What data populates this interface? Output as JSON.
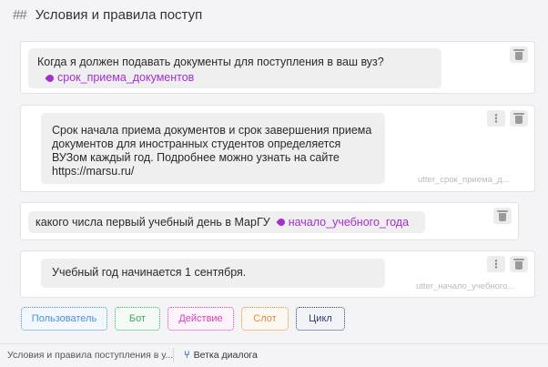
{
  "header": {
    "hash_icon": "hash-icon",
    "title": "Условия и правила поступ"
  },
  "steps": [
    {
      "type": "user",
      "text": "Когда я должен подавать документы для поступления в ваш вуз?",
      "intent": "срок_приема_документов"
    },
    {
      "type": "bot",
      "lines": [
        "Срок начала приема документов и срок завершения приема",
        "документов для иностранных студентов определяется",
        "ВУЗом каждый год. Подробнее можно узнать на сайте",
        "https://marsu.ru/"
      ],
      "utter": "utter_срок_приема_д..."
    },
    {
      "type": "user",
      "text": "какого числа первый учебный день в МарГУ",
      "intent": "начало_учебного_года"
    },
    {
      "type": "bot",
      "text": "Учебный год начинается 1 сентября.",
      "utter": "utter_начало_учебного..."
    }
  ],
  "add_buttons": [
    {
      "label": "Пользователь",
      "color": "#4a90d9"
    },
    {
      "label": "Бот",
      "color": "#3dab5a"
    },
    {
      "label": "Действие",
      "color": "#d63fb8"
    },
    {
      "label": "Слот",
      "color": "#e08a3c"
    },
    {
      "label": "Цикл",
      "color": "#2f3f6f"
    }
  ],
  "footer": {
    "breadcrumb": "Условия и правила поступления в у...",
    "branch_label": "Ветка диалога",
    "branch_icon": "branch-icon"
  }
}
